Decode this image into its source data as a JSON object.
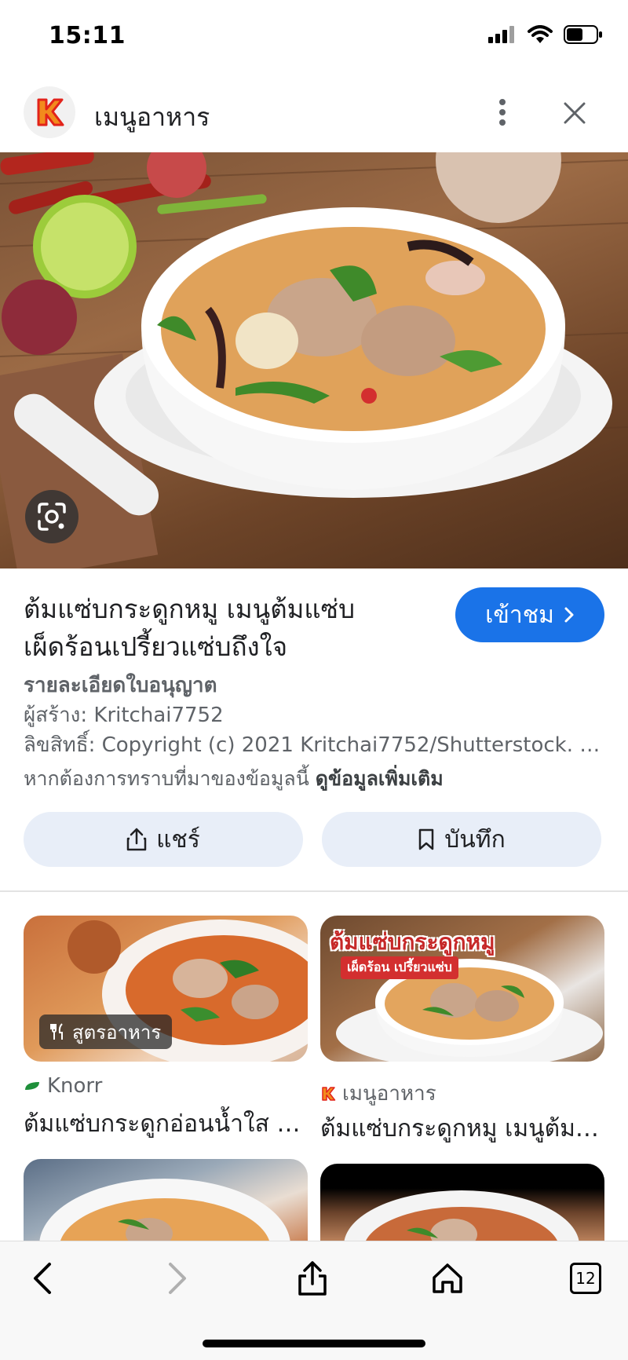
{
  "status_bar": {
    "time": "15:11"
  },
  "header": {
    "site_title": "เมนูอาหาร"
  },
  "details": {
    "title_line1": "ต้มแซ่บกระดูกหมู เมนูต้มแซ่บ",
    "title_line2": "เผ็ดร้อนเปรี้ยวแซ่บถึงใจ",
    "visit_label": "เข้าชม",
    "license_title": "รายละเอียดใบอนุญาต",
    "creator": "ผู้สร้าง: Kritchai7752",
    "rights": "ลิขสิทธิ์: Copyright (c) 2021 Kritchai7752/Shutterstock. All Rights Reserved.",
    "source_prefix": "หากต้องการทราบที่มาของข้อมูลนี้ ",
    "source_link": "ดูข้อมูลเพิ่มเติม"
  },
  "actions": {
    "share_label": "แชร์",
    "save_label": "บันทึก"
  },
  "related": [
    {
      "badge": "สูตรอาหาร",
      "source": "Knorr",
      "caption": "ต้มแซ่บกระดูกอ่อนน้ำใส สูตรเด็ด"
    },
    {
      "overlay_title": "ต้มแซ่บกระดูกหมู",
      "overlay_sub": "เผ็ดร้อน เปรี้ยวแซ่บ",
      "source": "เมนูอาหาร",
      "caption": "ต้มแซ่บกระดูกหมู เมนูต้มแซ่บ"
    }
  ],
  "toolbar": {
    "tabs_count": "12"
  },
  "colors": {
    "accent": "#1a73e8",
    "pill_bg": "#e8eef8",
    "brand_orange": "#f28b1c"
  }
}
